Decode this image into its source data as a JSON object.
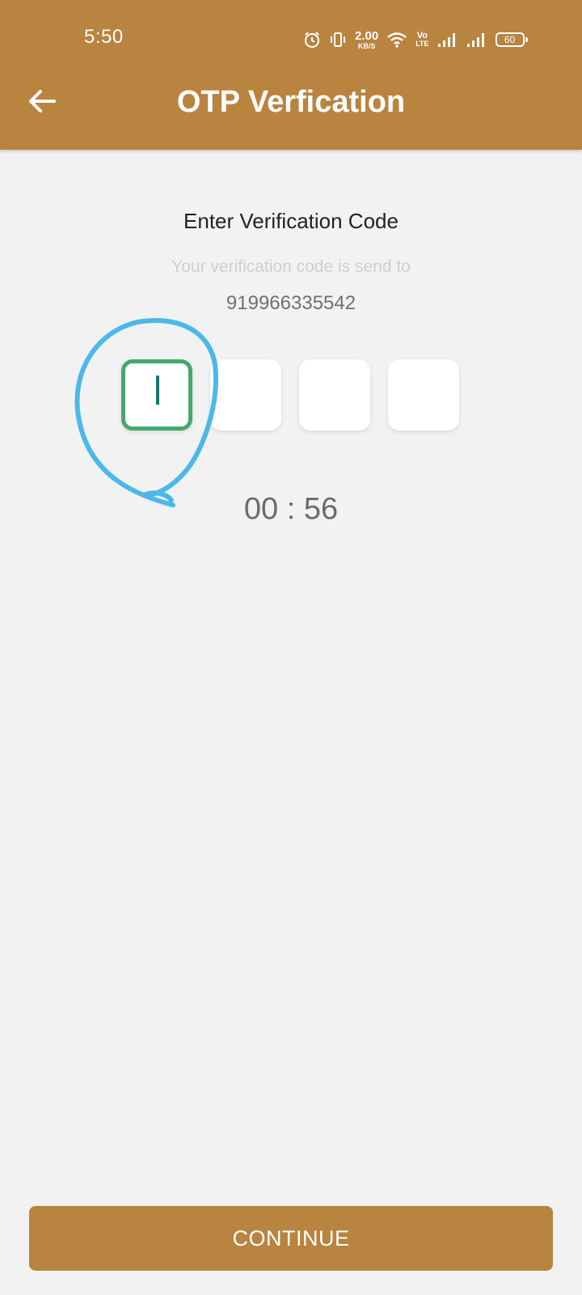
{
  "status_bar": {
    "time": "5:50",
    "net_speed_value": "2.00",
    "net_speed_unit": "KB/S",
    "volte_top": "Vo",
    "volte_bottom": "LTE",
    "battery": "60",
    "icons": [
      "alarm-icon",
      "vibrate-icon",
      "wifi-icon",
      "signal-icon",
      "signal-icon"
    ]
  },
  "header": {
    "title": "OTP Verfication",
    "back_icon": "arrow-left-icon"
  },
  "main": {
    "heading": "Enter Verification Code",
    "subtext": "Your verification code is send to",
    "phone": "919966335542",
    "otp_digits": [
      "",
      "",
      "",
      ""
    ],
    "timer": "00 : 56"
  },
  "footer": {
    "continue_label": "CONTINUE"
  },
  "colors": {
    "brand": "#b8843f",
    "background": "#f2f2f2",
    "active_box_border": "#46a86a",
    "caret": "#17756b",
    "annotation": "#4cb8e8"
  }
}
